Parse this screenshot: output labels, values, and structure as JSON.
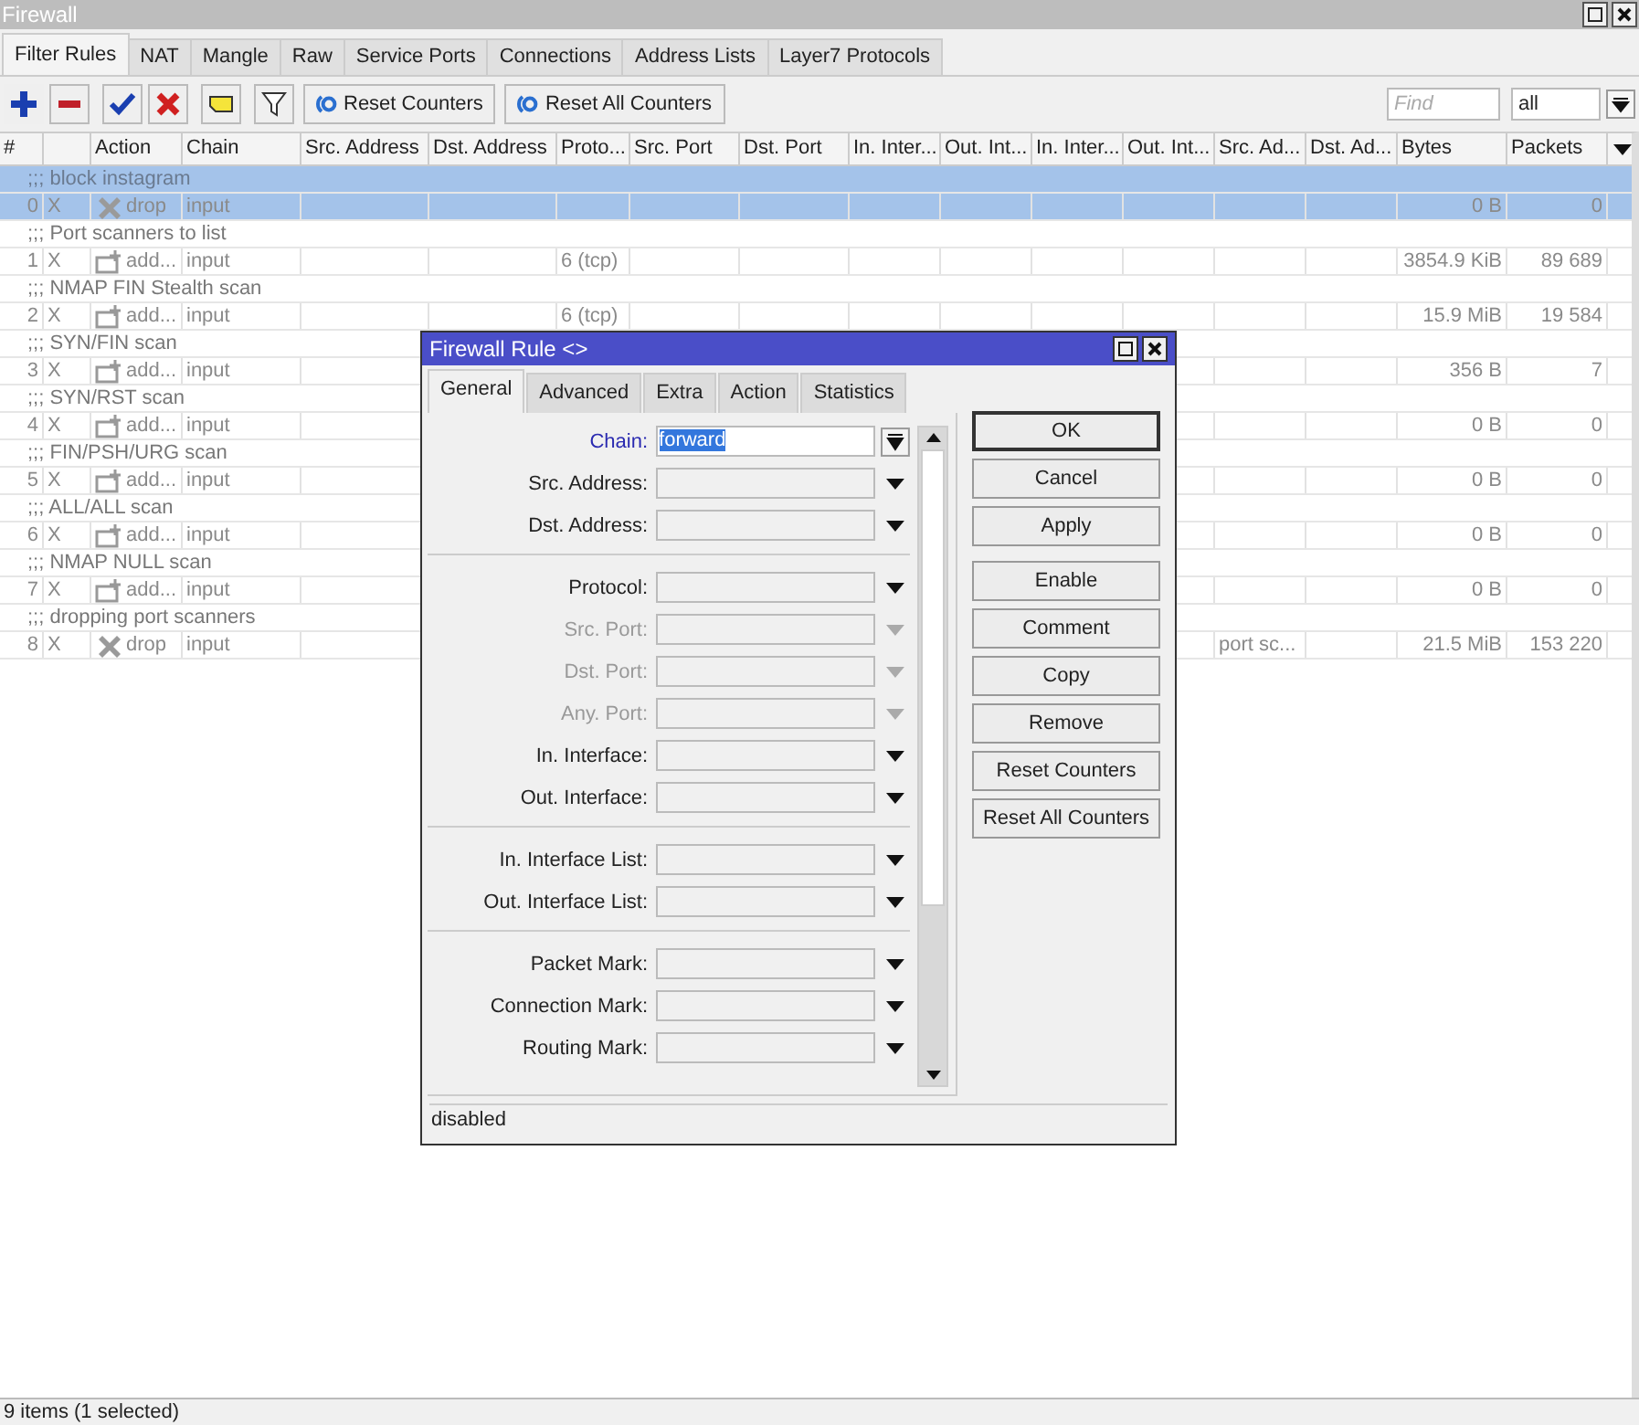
{
  "window": {
    "title": "Firewall"
  },
  "tabs": [
    {
      "label": "Filter Rules",
      "selected": true
    },
    {
      "label": "NAT",
      "selected": false
    },
    {
      "label": "Mangle",
      "selected": false
    },
    {
      "label": "Raw",
      "selected": false
    },
    {
      "label": "Service Ports",
      "selected": false
    },
    {
      "label": "Connections",
      "selected": false
    },
    {
      "label": "Address Lists",
      "selected": false
    },
    {
      "label": "Layer7 Protocols",
      "selected": false
    }
  ],
  "toolbar": {
    "buttons": [
      "Reset Counters",
      "Reset All Counters"
    ],
    "find_placeholder": "Find",
    "filter": "all"
  },
  "table": {
    "columns": [
      "#",
      "Action",
      "Chain",
      "Src. Address",
      "Dst. Address",
      "Proto...",
      "Src. Port",
      "Dst. Port",
      "In. Inter...",
      "Out. Int...",
      "In. Inter...",
      "Out. Int...",
      "Src. Ad...",
      "Dst. Ad...",
      "Bytes",
      "Packets"
    ],
    "rows": [
      {
        "comment": ";;; block instagram",
        "number": "0",
        "flag": "X",
        "kind": "drop",
        "action": "drop",
        "chain": "input",
        "bytes": "0 B",
        "packets": "0",
        "selected": true,
        "disabled": true
      },
      {
        "comment": ";;; Port scanners to list",
        "number": "1",
        "flag": "X",
        "kind": "add",
        "action": "add...",
        "chain": "input",
        "protocol": "6 (tcp)",
        "bytes": "3854.9 KiB",
        "packets": "89 689",
        "selected": false,
        "disabled": true
      },
      {
        "comment": ";;; NMAP FIN Stealth scan",
        "number": "2",
        "flag": "X",
        "kind": "add",
        "action": "add...",
        "chain": "input",
        "protocol": "6 (tcp)",
        "bytes": "15.9 MiB",
        "packets": "19 584",
        "selected": false,
        "disabled": true
      },
      {
        "comment": ";;; SYN/FIN scan",
        "number": "3",
        "flag": "X",
        "kind": "add",
        "action": "add...",
        "chain": "input",
        "bytes": "356 B",
        "packets": "7",
        "selected": false,
        "disabled": true
      },
      {
        "comment": ";;; SYN/RST scan",
        "number": "4",
        "flag": "X",
        "kind": "add",
        "action": "add...",
        "chain": "input",
        "bytes": "0 B",
        "packets": "0",
        "selected": false,
        "disabled": true
      },
      {
        "comment": ";;; FIN/PSH/URG scan",
        "number": "5",
        "flag": "X",
        "kind": "add",
        "action": "add...",
        "chain": "input",
        "bytes": "0 B",
        "packets": "0",
        "selected": false,
        "disabled": true
      },
      {
        "comment": ";;; ALL/ALL scan",
        "number": "6",
        "flag": "X",
        "kind": "add",
        "action": "add...",
        "chain": "input",
        "bytes": "0 B",
        "packets": "0",
        "selected": false,
        "disabled": true
      },
      {
        "comment": ";;; NMAP NULL scan",
        "number": "7",
        "flag": "X",
        "kind": "add",
        "action": "add...",
        "chain": "input",
        "bytes": "0 B",
        "packets": "0",
        "selected": false,
        "disabled": true
      },
      {
        "comment": ";;; dropping port scanners",
        "number": "8",
        "flag": "X",
        "kind": "drop",
        "action": "drop",
        "chain": "input",
        "src_address_list": "port sc...",
        "bytes": "21.5 MiB",
        "packets": "153 220",
        "selected": false,
        "disabled": true
      }
    ]
  },
  "status_bar": "9 items (1 selected)",
  "dialog": {
    "title": "Firewall Rule <>",
    "tabs": [
      {
        "label": "General",
        "selected": true
      },
      {
        "label": "Advanced",
        "selected": false
      },
      {
        "label": "Extra",
        "selected": false
      },
      {
        "label": "Action",
        "selected": false
      },
      {
        "label": "Statistics",
        "selected": false
      }
    ],
    "field_groups": [
      [
        {
          "label": "Chain:",
          "value": "forward",
          "kind": "combo",
          "set": true,
          "disabled": false
        },
        {
          "label": "Src. Address:",
          "kind": "dropdown",
          "set": false,
          "disabled": false
        },
        {
          "label": "Dst. Address:",
          "kind": "dropdown",
          "set": false,
          "disabled": false
        }
      ],
      [
        {
          "label": "Protocol:",
          "kind": "dropdown",
          "set": false,
          "disabled": false
        },
        {
          "label": "Src. Port:",
          "kind": "dropdown",
          "set": false,
          "disabled": true
        },
        {
          "label": "Dst. Port:",
          "kind": "dropdown",
          "set": false,
          "disabled": true
        },
        {
          "label": "Any. Port:",
          "kind": "dropdown",
          "set": false,
          "disabled": true
        },
        {
          "label": "In. Interface:",
          "kind": "dropdown",
          "set": false,
          "disabled": false
        },
        {
          "label": "Out. Interface:",
          "kind": "dropdown",
          "set": false,
          "disabled": false
        }
      ],
      [
        {
          "label": "In. Interface List:",
          "kind": "dropdown",
          "set": false,
          "disabled": false
        },
        {
          "label": "Out. Interface List:",
          "kind": "dropdown",
          "set": false,
          "disabled": false
        }
      ],
      [
        {
          "label": "Packet Mark:",
          "kind": "dropdown",
          "set": false,
          "disabled": false
        },
        {
          "label": "Connection Mark:",
          "kind": "dropdown",
          "set": false,
          "disabled": false
        },
        {
          "label": "Routing Mark:",
          "kind": "dropdown",
          "set": false,
          "disabled": false
        }
      ]
    ],
    "button_groups": [
      [
        {
          "label": "OK",
          "default": true
        },
        {
          "label": "Cancel",
          "default": false
        },
        {
          "label": "Apply",
          "default": false
        }
      ],
      [
        {
          "label": "Enable",
          "default": false
        },
        {
          "label": "Comment",
          "default": false
        },
        {
          "label": "Copy",
          "default": false
        },
        {
          "label": "Remove",
          "default": false
        },
        {
          "label": "Reset Counters",
          "default": false
        },
        {
          "label": "Reset All Counters",
          "default": false
        }
      ]
    ],
    "status": "disabled"
  }
}
